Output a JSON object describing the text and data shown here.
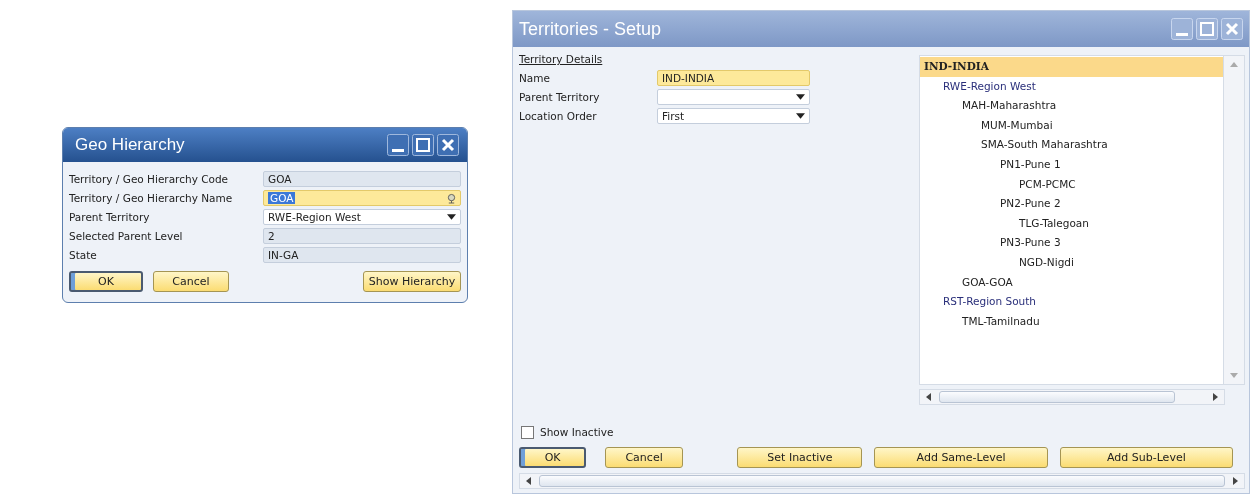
{
  "geo_dialog": {
    "title": "Geo Hierarchy",
    "fields": [
      {
        "label": "Territory / Geo Hierarchy Code",
        "value": "GOA",
        "kind": "readonly",
        "focused": false,
        "text_selected": false
      },
      {
        "label": "Territory / Geo Hierarchy Name",
        "value": "GOA",
        "kind": "lookup",
        "focused": true,
        "text_selected": true
      },
      {
        "label": "Parent Territory",
        "value": "RWE-Region West",
        "kind": "dropdown",
        "focused": false,
        "text_selected": false
      },
      {
        "label": "Selected Parent Level",
        "value": "2",
        "kind": "readonly",
        "focused": false,
        "text_selected": false
      },
      {
        "label": "State",
        "value": "IN-GA",
        "kind": "readonly",
        "focused": false,
        "text_selected": false
      }
    ],
    "buttons": [
      {
        "label": "OK",
        "default": true
      },
      {
        "label": "Cancel",
        "default": false
      }
    ],
    "side_button": {
      "label": "Show Hierarchy",
      "default": false
    }
  },
  "setup_window": {
    "title": "Territories - Setup",
    "section": "Territory Details",
    "fields": [
      {
        "label": "Name",
        "value": "IND-INDIA",
        "kind": "text",
        "focused": true
      },
      {
        "label": "Parent Territory",
        "kind": "dropdown",
        "focused": false
      },
      {
        "label": "Location Order",
        "value": "First",
        "kind": "dropdown",
        "focused": false
      }
    ],
    "tree": [
      {
        "label": "IND-INDIA",
        "selected": true,
        "children": [
          {
            "label": "RWE-Region West",
            "selected": false,
            "children": [
              {
                "label": "MAH-Maharashtra",
                "selected": false,
                "children": [
                  {
                    "label": "MUM-Mumbai",
                    "selected": false
                  },
                  {
                    "label": "SMA-South Maharashtra",
                    "selected": false,
                    "children": [
                      {
                        "label": "PN1-Pune 1",
                        "selected": false,
                        "children": [
                          {
                            "label": "PCM-PCMC",
                            "selected": false
                          }
                        ]
                      },
                      {
                        "label": "PN2-Pune 2",
                        "selected": false,
                        "children": [
                          {
                            "label": "TLG-Talegoan",
                            "selected": false
                          }
                        ]
                      },
                      {
                        "label": "PN3-Pune 3",
                        "selected": false,
                        "children": [
                          {
                            "label": "NGD-Nigdi",
                            "selected": false
                          }
                        ]
                      }
                    ]
                  }
                ]
              },
              {
                "label": "GOA-GOA",
                "selected": false
              }
            ]
          },
          {
            "label": "RST-Region South",
            "selected": false,
            "children": [
              {
                "label": "TML-Tamilnadu",
                "selected": false
              }
            ]
          }
        ]
      }
    ],
    "show_inactive": {
      "label": "Show Inactive",
      "checked": false
    },
    "buttons": [
      {
        "label": "OK",
        "default": true
      },
      {
        "label": "Cancel",
        "default": false
      }
    ],
    "action_buttons": [
      {
        "label": "Set Inactive",
        "default": false
      },
      {
        "label": "Add Same-Level",
        "default": false
      },
      {
        "label": "Add Sub-Level",
        "default": false
      }
    ]
  }
}
